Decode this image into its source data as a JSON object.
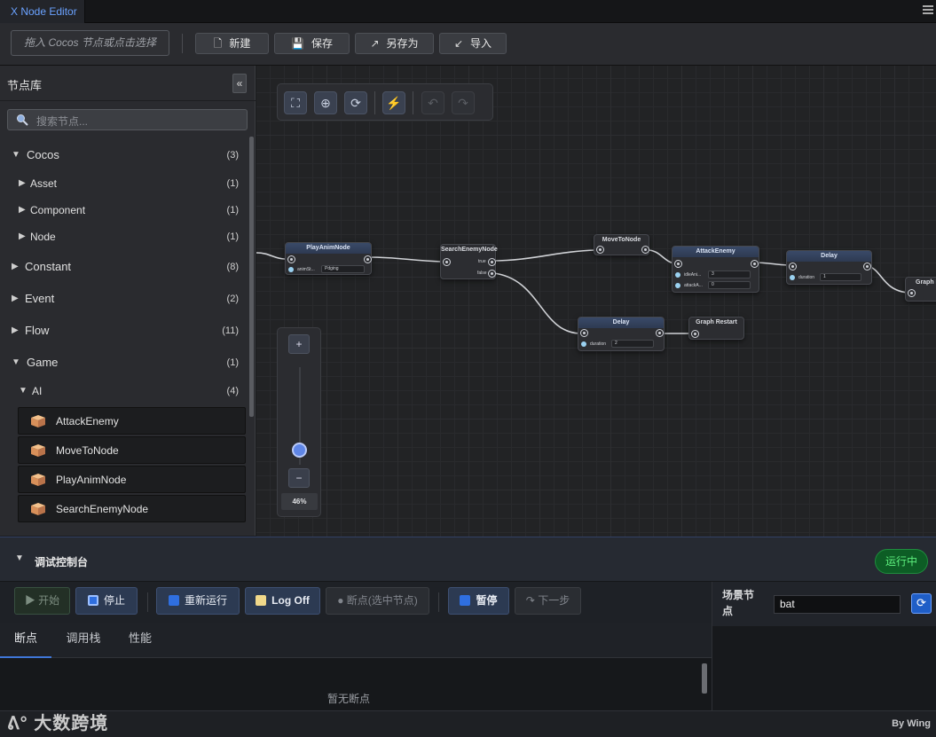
{
  "window": {
    "title": "X Node Editor"
  },
  "toolbar": {
    "drop_hint": "拖入 Cocos 节点或点击选择",
    "new_label": "新建",
    "save_label": "保存",
    "save_as_label": "另存为",
    "import_label": "导入"
  },
  "sidebar": {
    "title": "节点库",
    "collapse": "«",
    "search_placeholder": "搜索节点...",
    "tree": [
      {
        "label": "Cocos",
        "count": "(3)",
        "expanded": true
      },
      {
        "label": "Asset",
        "count": "(1)"
      },
      {
        "label": "Component",
        "count": "(1)"
      },
      {
        "label": "Node",
        "count": "(1)"
      },
      {
        "label": "Constant",
        "count": "(8)"
      },
      {
        "label": "Event",
        "count": "(2)"
      },
      {
        "label": "Flow",
        "count": "(11)"
      },
      {
        "label": "Game",
        "count": "(1)",
        "expanded": true
      },
      {
        "label": "AI",
        "count": "(4)",
        "expanded": true
      }
    ],
    "leaves": [
      "AttackEnemy",
      "MoveToNode",
      "PlayAnimNode",
      "SearchEnemyNode"
    ]
  },
  "canvas": {
    "zoom_in": "+",
    "zoom_out": "−",
    "zoom_level": "46%",
    "zoom_fraction": 0.46,
    "nodes": {
      "play_anim": {
        "title": "PlayAnimNode",
        "param": "animSt...",
        "value": "Pdging"
      },
      "search_enemy": {
        "title": "SearchEnemyNode",
        "out_true": "true",
        "out_false": "false"
      },
      "move_to": {
        "title": "MoveToNode"
      },
      "attack": {
        "title": "AttackEnemy",
        "p1": "idleAni...",
        "v1": "3",
        "p2": "attackA...",
        "v2": "0"
      },
      "delay1": {
        "title": "Delay",
        "param": "duration",
        "value": "1"
      },
      "graph_r1": {
        "title": "Graph R"
      },
      "delay2": {
        "title": "Delay",
        "param": "duration",
        "value": "2"
      },
      "graph_restart": {
        "title": "Graph Restart"
      }
    }
  },
  "console": {
    "title": "调试控制台",
    "status": "运行中",
    "start_label": "开始",
    "stop_label": "停止",
    "restart_label": "重新运行",
    "log_label": "Log Off",
    "breakpoint_label": "断点(选中节点)",
    "pause_label": "暂停",
    "step_label": "下一步",
    "tabs": [
      "断点",
      "调用栈",
      "性能"
    ],
    "empty_text": "暂无断点",
    "scene_label": "场景节点",
    "scene_value": "bat"
  },
  "footer": {
    "watermark": "大数跨境",
    "byline": "By Wing"
  },
  "colors": {
    "accent": "#3f77d8",
    "running": "#5ef07e",
    "link": "#6aa2ff"
  }
}
